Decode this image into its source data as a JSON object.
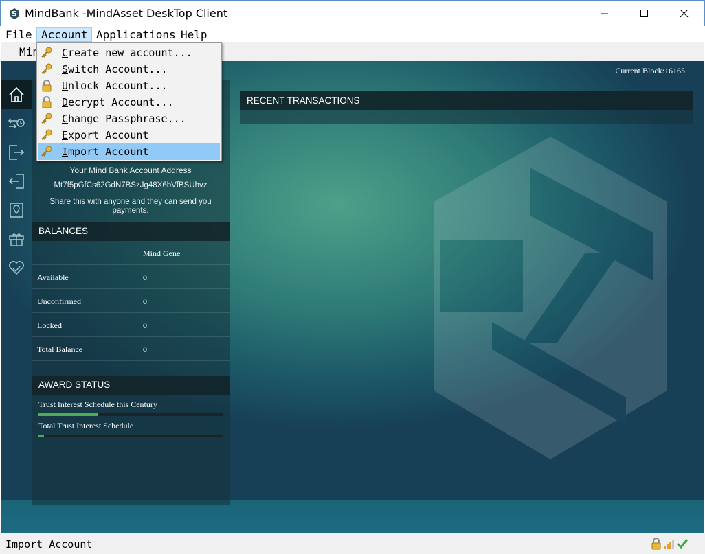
{
  "window": {
    "title": "MindBank -MindAsset DeskTop Client"
  },
  "menubar": {
    "items": [
      {
        "label": "File"
      },
      {
        "label": "Account"
      },
      {
        "label": "Applications"
      },
      {
        "label": "Help"
      }
    ]
  },
  "toolbar": {
    "tab_label": "Min"
  },
  "account_menu": {
    "items": [
      {
        "label": "Create new account...",
        "icon": "key-icon"
      },
      {
        "label": "Switch Account...",
        "icon": "key-icon"
      },
      {
        "label": "Unlock Account...",
        "icon": "padlock-icon"
      },
      {
        "label": "Decrypt Account...",
        "icon": "padlock-icon"
      },
      {
        "label": "Change Passphrase...",
        "icon": "key-icon"
      },
      {
        "label": "Export Account",
        "icon": "key-icon"
      },
      {
        "label": "Import Account",
        "icon": "key-icon",
        "highlighted": true
      }
    ]
  },
  "header": {
    "current_block": "Current Block:16165"
  },
  "sidebar": {
    "icons": [
      "home-icon",
      "transactions-icon",
      "send-icon",
      "receive-icon",
      "location-icon",
      "gift-icon",
      "heart-hands-icon"
    ]
  },
  "account": {
    "address_label": "Your Mind Bank Account Address",
    "address": "Mt7f5pGfCs62GdN7BSzJg48X6bVfBSUhvz",
    "share_note": "Share this with anyone and they can send you payments."
  },
  "balances": {
    "title": "BALANCES",
    "column": "Mind Gene",
    "rows": [
      {
        "label": "Available",
        "value": "0"
      },
      {
        "label": "Unconfirmed",
        "value": "0"
      },
      {
        "label": "Locked",
        "value": "0"
      },
      {
        "label": "Total Balance",
        "value": "0"
      }
    ]
  },
  "award": {
    "title": "AWARD STATUS",
    "items": [
      {
        "label": "Trust Interest Schedule this Century",
        "progress": 0.32
      },
      {
        "label": "Total Trust Interest Schedule",
        "progress": 0.03
      }
    ]
  },
  "recent": {
    "title": "RECENT TRANSACTIONS"
  },
  "statusbar": {
    "text": "Import Account",
    "icons": [
      "lock-icon",
      "signal-bars-icon",
      "checkmark-icon"
    ]
  },
  "colors": {
    "accent_green": "#4caf50",
    "menu_highlight": "#91c9f7",
    "panel_header": "#122328",
    "background_teal": "#2f7c78"
  }
}
